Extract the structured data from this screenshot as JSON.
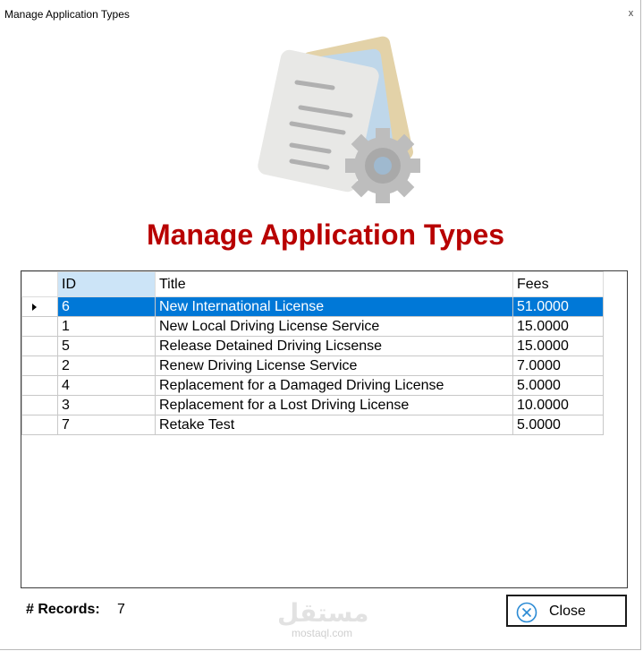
{
  "window": {
    "title": "Manage Application Types",
    "close_glyph": "x"
  },
  "header": {
    "heading": "Manage Application Types",
    "heading_color": "#b80000",
    "icon": "document-settings-icon"
  },
  "grid": {
    "columns": [
      "ID",
      "Title",
      "Fees"
    ],
    "selected_row_index": 0,
    "selection_color": "#0078d7",
    "rows": [
      {
        "id": "6",
        "title": "New International License",
        "fees": "51.0000"
      },
      {
        "id": "1",
        "title": "New Local Driving License Service",
        "fees": "15.0000"
      },
      {
        "id": "5",
        "title": "Release Detained Driving Licsense",
        "fees": "15.0000"
      },
      {
        "id": "2",
        "title": "Renew Driving License Service",
        "fees": "7.0000"
      },
      {
        "id": "4",
        "title": "Replacement for a Damaged Driving License",
        "fees": "5.0000"
      },
      {
        "id": "3",
        "title": "Replacement for a Lost Driving License",
        "fees": "10.0000"
      },
      {
        "id": "7",
        "title": "Retake Test",
        "fees": "5.0000"
      }
    ]
  },
  "footer": {
    "records_label": "# Records:",
    "records_count": "7",
    "close_button_label": "Close",
    "close_button_icon": "close-circle-icon"
  },
  "watermark": {
    "arabic": "مستقل",
    "latin": "mostaql.com"
  }
}
